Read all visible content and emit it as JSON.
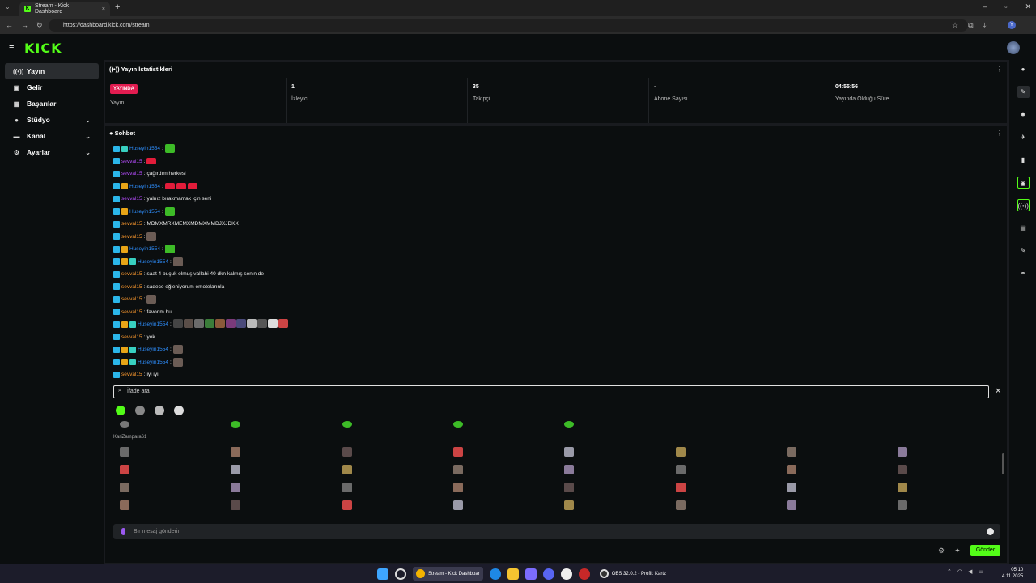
{
  "browser": {
    "tab_title": "Stream - Kick Dashboard",
    "tab_close": "×",
    "new_tab": "+",
    "url": "https://dashboard.kick.com/stream",
    "profile_initial": "Y"
  },
  "header": {
    "logo": "KICK"
  },
  "sidebar": {
    "items": [
      {
        "label": "Yayın",
        "icon": "broadcast-icon"
      },
      {
        "label": "Gelir",
        "icon": "wallet-icon"
      },
      {
        "label": "Başarılar",
        "icon": "trophy-icon"
      },
      {
        "label": "Stüdyo",
        "icon": "studio-icon"
      },
      {
        "label": "Kanal",
        "icon": "channel-icon"
      },
      {
        "label": "Ayarlar",
        "icon": "gear-icon"
      }
    ]
  },
  "stats": {
    "title": "Yayın İstatistikleri",
    "status_badge": "YAYINDA",
    "status_label": "Yayın",
    "viewers_value": "1",
    "viewers_label": "İzleyici",
    "followers_value": "35",
    "followers_label": "Takipçi",
    "subs_value": "-",
    "subs_label": "Abone Sayısı",
    "uptime_value": "04:55:56",
    "uptime_label": "Yayında Olduğu Süre"
  },
  "chat": {
    "title": "Sohbet",
    "messages": [
      {
        "user": "Huseyin1554",
        "text": ""
      },
      {
        "user": "sevval15",
        "text": ""
      },
      {
        "user": "sevval15",
        "text": "çağırdım herkesi"
      },
      {
        "user": "Huseyin1554",
        "text": ""
      },
      {
        "user": "sevval15",
        "text": "yalnız bırakmamak için seni"
      },
      {
        "user": "Huseyin1554",
        "text": ""
      },
      {
        "user": "sevval15",
        "text": "MDMXMRXMEMXMDMXMMDJXJDKX"
      },
      {
        "user": "sevval15",
        "text": ""
      },
      {
        "user": "Huseyin1554",
        "text": ""
      },
      {
        "user": "Huseyin1554",
        "text": ""
      },
      {
        "user": "sevval15",
        "text": "saat 4 buçuk olmuş vallahi 40 dkn kalmış senin de"
      },
      {
        "user": "sevval15",
        "text": "sadece eğleniyorum emotelarınla"
      },
      {
        "user": "sevval15",
        "text": ""
      },
      {
        "user": "sevval15",
        "text": "favorim bu"
      },
      {
        "user": "Huseyin1554",
        "text": ""
      },
      {
        "user": "sevval15",
        "text": "yok"
      },
      {
        "user": "Huseyin1554",
        "text": ""
      },
      {
        "user": "Huseyin1554",
        "text": ""
      },
      {
        "user": "sevval15",
        "text": "iyi iyi"
      }
    ],
    "emote_search_placeholder": "İfade ara",
    "emote_set_name": "KariZampara61",
    "message_placeholder": "Bir mesaj gönderin",
    "send_label": "Gönder"
  },
  "taskbar": {
    "browser_label": "Stream - Kick Dashboar",
    "obs_label": "OBS 32.0.2 - Profil: Kartz",
    "time": "05:10",
    "date": "4.11.2025"
  },
  "colors": {
    "accent": "#53fc18",
    "live_badge": "#e21c50"
  }
}
